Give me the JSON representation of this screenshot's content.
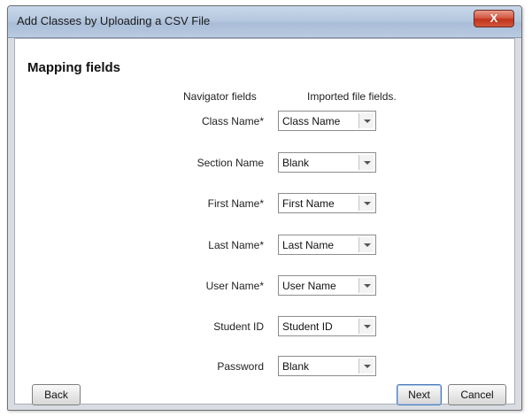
{
  "window": {
    "title": "Add Classes by Uploading a CSV File",
    "close_label": "X"
  },
  "main": {
    "heading": "Mapping fields",
    "col_navigator": "Navigator fields",
    "col_imported": "Imported file fields."
  },
  "fields": [
    {
      "label": "Class Name*",
      "value": "Class Name"
    },
    {
      "label": "Section Name",
      "value": "Blank"
    },
    {
      "label": "First Name*",
      "value": "First Name"
    },
    {
      "label": "Last Name*",
      "value": "Last Name"
    },
    {
      "label": "User Name*",
      "value": "User Name"
    },
    {
      "label": "Student ID",
      "value": "Student ID"
    },
    {
      "label": "Password",
      "value": "Blank"
    }
  ],
  "buttons": {
    "back": "Back",
    "next": "Next",
    "cancel": "Cancel"
  }
}
